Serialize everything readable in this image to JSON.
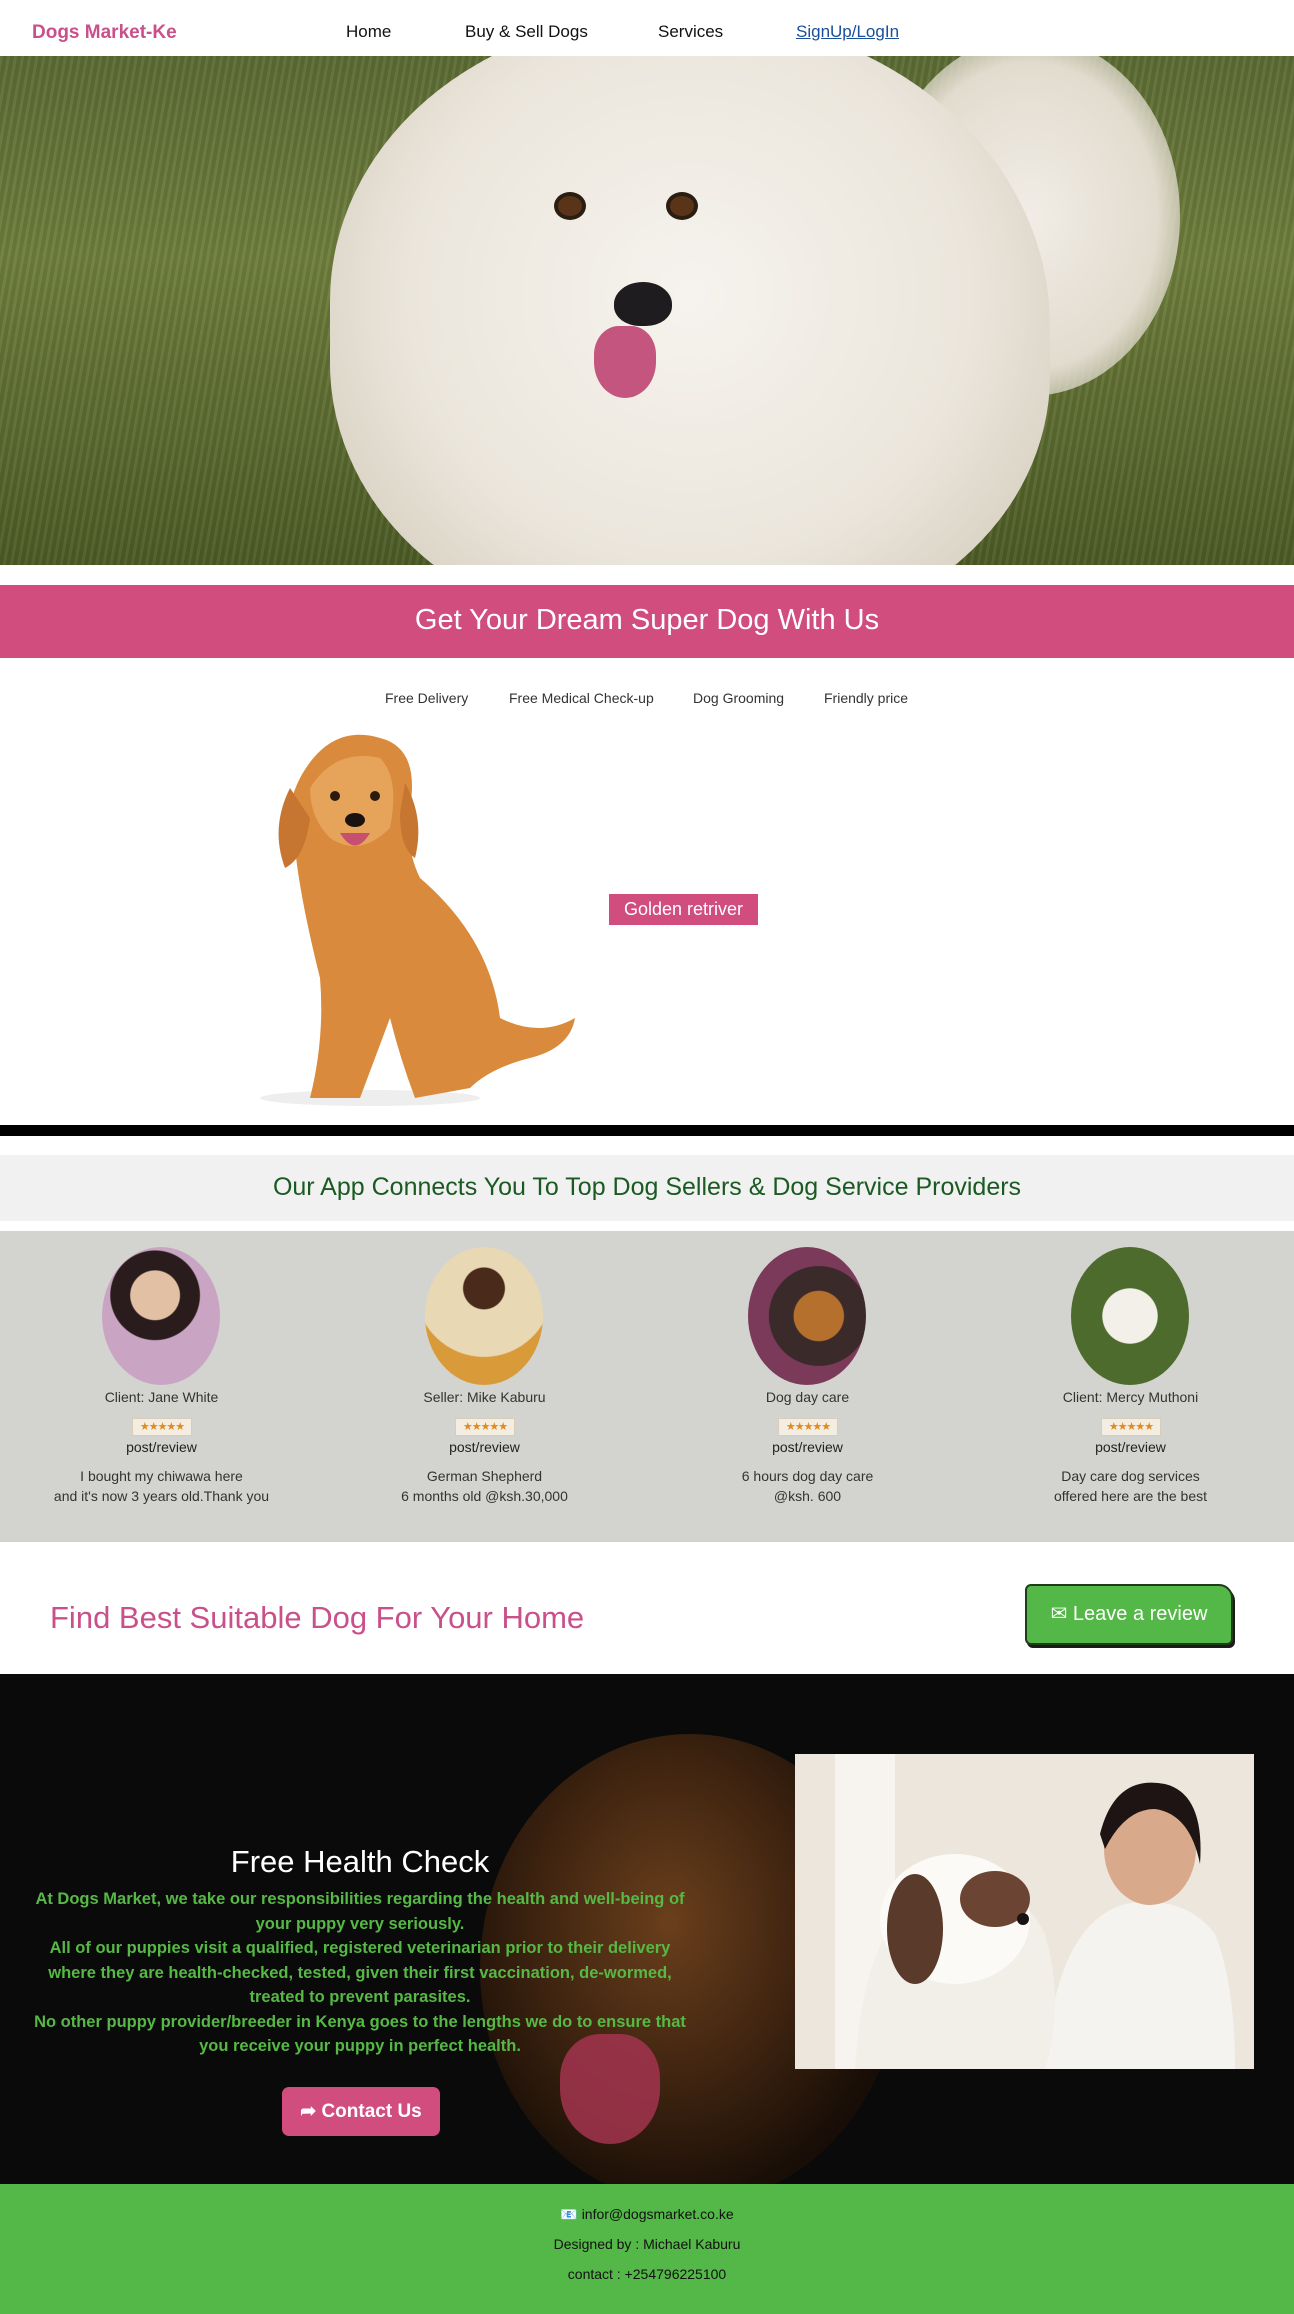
{
  "nav": {
    "brand": "Dogs Market-Ke",
    "links": [
      "Home",
      "Buy & Sell Dogs",
      "Services",
      "SignUp/LogIn"
    ]
  },
  "hero": {
    "image": "white-spitz-dog-photo"
  },
  "banner": {
    "title": "Get Your Dream Super Dog With Us"
  },
  "features": [
    "Free Delivery",
    "Free Medical Check-up",
    "Dog Grooming",
    "Friendly price"
  ],
  "featured_dog": {
    "label": "Golden retriver",
    "image": "golden-retriever-photo"
  },
  "connects": {
    "title": "Our App Connects You To Top Dog Sellers & Dog Service Providers"
  },
  "reviews": [
    {
      "name": "Client: Jane White",
      "stars": "★★★★★",
      "post": "post/review",
      "line1": "I bought my chiwawa here",
      "line2": "and it's now 3 years old.Thank you"
    },
    {
      "name": "Seller: Mike Kaburu",
      "stars": "★★★★★",
      "post": "post/review",
      "line1": "German Shepherd",
      "line2": "6 months old @ksh.30,000"
    },
    {
      "name": "Dog day care",
      "stars": "★★★★★",
      "post": "post/review",
      "line1": "6 hours dog day care",
      "line2": "@ksh. 600"
    },
    {
      "name": "Client: Mercy Muthoni",
      "stars": "★★★★★",
      "post": "post/review",
      "line1": "Day care dog services",
      "line2": "offered here are the best"
    }
  ],
  "find": {
    "title": "Find Best Suitable Dog For Your Home",
    "button": "Leave a review"
  },
  "health": {
    "title": "Free Health Check",
    "lines": [
      "At Dogs Market, we take our responsibilities regarding the health and well-being of your puppy very seriously.",
      "All of our puppies visit a qualified, registered veterinarian prior to their delivery where they are health-checked, tested, given their first vaccination, de-wormed, treated to prevent parasites.",
      "No other puppy provider/breeder in Kenya goes to the lengths we do to ensure that you receive your puppy in perfect health."
    ],
    "button": "Contact Us"
  },
  "footer": {
    "email": "infor@dogsmarket.co.ke",
    "designer": "Designed by : Michael Kaburu",
    "contact": "contact : +254796225100"
  },
  "colors": {
    "pink": "#d04d7d",
    "green": "#53b847",
    "dark_green": "#1b5a23"
  }
}
